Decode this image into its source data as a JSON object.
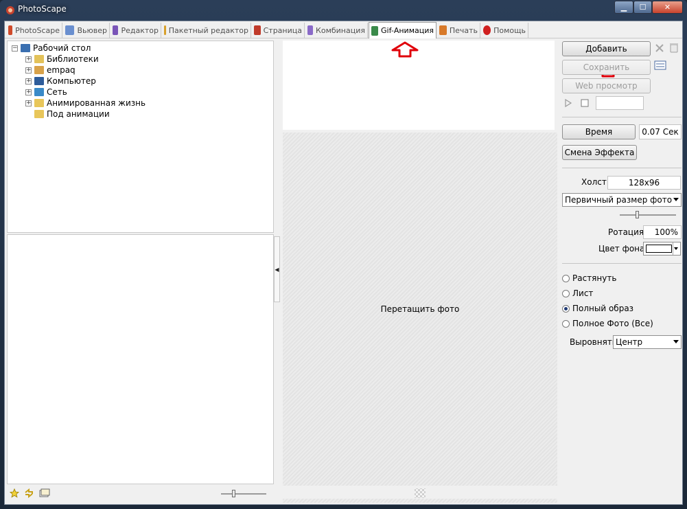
{
  "window": {
    "title": "PhotoScape",
    "min": "▁",
    "max": "☐",
    "close": "✕"
  },
  "tabs": [
    {
      "label": "PhotoScape",
      "color": "#d04a2a"
    },
    {
      "label": "Вьювер",
      "color": "#6a8fcf"
    },
    {
      "label": "Редактор",
      "color": "#7a55b8"
    },
    {
      "label": "Пакетный редактор",
      "color": "#d8a02a"
    },
    {
      "label": "Страница",
      "color": "#c03a2a"
    },
    {
      "label": "Комбинация",
      "color": "#8a6ac8"
    },
    {
      "label": "Gif-Анимация",
      "color": "#3a8a4a"
    },
    {
      "label": "Печать",
      "color": "#d87a2a"
    },
    {
      "label": "Помощь",
      "color": "#d02020"
    }
  ],
  "tree": {
    "root": "Рабочий стол",
    "items": [
      "Библиотеки",
      "empaq",
      "Компьютер",
      "Сеть",
      "Анимированная жизнь",
      "Под анимации"
    ]
  },
  "canvas": {
    "drop_text": "Перетащить фото"
  },
  "right": {
    "add_label": "Добавить",
    "save_label": "Сохранить",
    "web_preview_label": "Web просмотр",
    "time_label": "Время",
    "time_value": "0.07 Сек",
    "effect_label": "Смена Эффекта",
    "canvas_label": "Холст",
    "canvas_value": "128x96",
    "size_mode": "Первичный размер фото",
    "size_slider": 0.3,
    "rotation_label": "Ротация",
    "rotation_value": "100%",
    "bg_label": "Цвет фона",
    "bg_color": "#ffffff",
    "radios": [
      {
        "label": "Растянуть",
        "checked": false
      },
      {
        "label": "Лист",
        "checked": false
      },
      {
        "label": "Полный образ",
        "checked": true
      },
      {
        "label": "Полное Фото (Все)",
        "checked": false
      }
    ],
    "align_label": "Выровнять",
    "align_value": "Центр"
  },
  "thumb_slider": 0.25
}
